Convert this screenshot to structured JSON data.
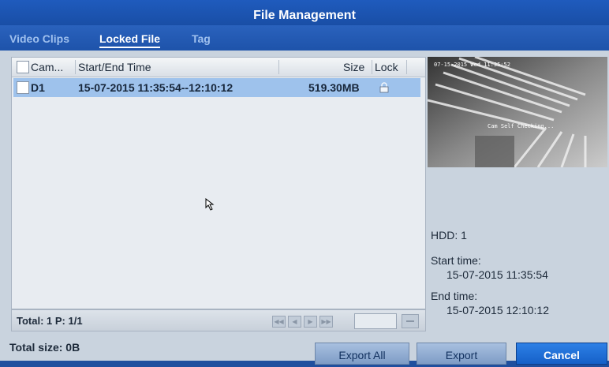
{
  "window": {
    "title": "File Management"
  },
  "tabs": [
    {
      "label": "Video Clips",
      "active": false
    },
    {
      "label": "Locked File",
      "active": true
    },
    {
      "label": "Tag",
      "active": false
    }
  ],
  "table": {
    "columns": [
      "Cam...",
      "Start/End Time",
      "Size",
      "Lock"
    ],
    "rows": [
      {
        "cam": "D1",
        "time": "15-07-2015 11:35:54--12:10:12",
        "size": "519.30MB",
        "lock_icon": "lock-icon",
        "selected": true
      }
    ]
  },
  "pager": {
    "status": "Total: 1  P: 1/1",
    "page_input": ""
  },
  "preview": {
    "overlay_date": "07-15-2015 Wed 11:35:52",
    "overlay_message": "Cam Self Checking..."
  },
  "details": {
    "hdd": "HDD: 1",
    "start_label": "Start time:",
    "start_value": "15-07-2015 11:35:54",
    "end_label": "End time:",
    "end_value": "15-07-2015 12:10:12"
  },
  "bottom": {
    "total_size": "Total size: 0B",
    "export_all": "Export All",
    "export": "Export",
    "cancel": "Cancel"
  },
  "colors": {
    "titlebar": "#1f5bbd",
    "selected_row": "#9ec2ec",
    "primary_button": "#1f6fd8"
  }
}
